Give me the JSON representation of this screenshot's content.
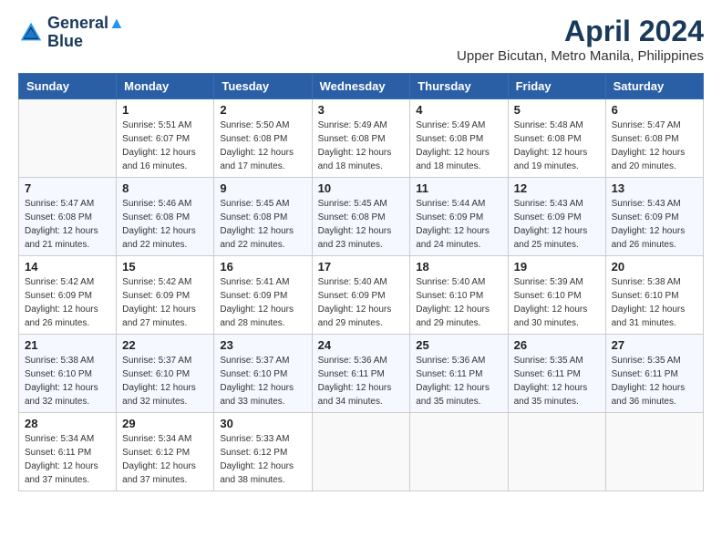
{
  "header": {
    "logo_line1": "General",
    "logo_line2": "Blue",
    "month": "April 2024",
    "location": "Upper Bicutan, Metro Manila, Philippines"
  },
  "columns": [
    "Sunday",
    "Monday",
    "Tuesday",
    "Wednesday",
    "Thursday",
    "Friday",
    "Saturday"
  ],
  "weeks": [
    [
      {
        "day": "",
        "info": ""
      },
      {
        "day": "1",
        "info": "Sunrise: 5:51 AM\nSunset: 6:07 PM\nDaylight: 12 hours\nand 16 minutes."
      },
      {
        "day": "2",
        "info": "Sunrise: 5:50 AM\nSunset: 6:08 PM\nDaylight: 12 hours\nand 17 minutes."
      },
      {
        "day": "3",
        "info": "Sunrise: 5:49 AM\nSunset: 6:08 PM\nDaylight: 12 hours\nand 18 minutes."
      },
      {
        "day": "4",
        "info": "Sunrise: 5:49 AM\nSunset: 6:08 PM\nDaylight: 12 hours\nand 18 minutes."
      },
      {
        "day": "5",
        "info": "Sunrise: 5:48 AM\nSunset: 6:08 PM\nDaylight: 12 hours\nand 19 minutes."
      },
      {
        "day": "6",
        "info": "Sunrise: 5:47 AM\nSunset: 6:08 PM\nDaylight: 12 hours\nand 20 minutes."
      }
    ],
    [
      {
        "day": "7",
        "info": "Sunrise: 5:47 AM\nSunset: 6:08 PM\nDaylight: 12 hours\nand 21 minutes."
      },
      {
        "day": "8",
        "info": "Sunrise: 5:46 AM\nSunset: 6:08 PM\nDaylight: 12 hours\nand 22 minutes."
      },
      {
        "day": "9",
        "info": "Sunrise: 5:45 AM\nSunset: 6:08 PM\nDaylight: 12 hours\nand 22 minutes."
      },
      {
        "day": "10",
        "info": "Sunrise: 5:45 AM\nSunset: 6:08 PM\nDaylight: 12 hours\nand 23 minutes."
      },
      {
        "day": "11",
        "info": "Sunrise: 5:44 AM\nSunset: 6:09 PM\nDaylight: 12 hours\nand 24 minutes."
      },
      {
        "day": "12",
        "info": "Sunrise: 5:43 AM\nSunset: 6:09 PM\nDaylight: 12 hours\nand 25 minutes."
      },
      {
        "day": "13",
        "info": "Sunrise: 5:43 AM\nSunset: 6:09 PM\nDaylight: 12 hours\nand 26 minutes."
      }
    ],
    [
      {
        "day": "14",
        "info": "Sunrise: 5:42 AM\nSunset: 6:09 PM\nDaylight: 12 hours\nand 26 minutes."
      },
      {
        "day": "15",
        "info": "Sunrise: 5:42 AM\nSunset: 6:09 PM\nDaylight: 12 hours\nand 27 minutes."
      },
      {
        "day": "16",
        "info": "Sunrise: 5:41 AM\nSunset: 6:09 PM\nDaylight: 12 hours\nand 28 minutes."
      },
      {
        "day": "17",
        "info": "Sunrise: 5:40 AM\nSunset: 6:09 PM\nDaylight: 12 hours\nand 29 minutes."
      },
      {
        "day": "18",
        "info": "Sunrise: 5:40 AM\nSunset: 6:10 PM\nDaylight: 12 hours\nand 29 minutes."
      },
      {
        "day": "19",
        "info": "Sunrise: 5:39 AM\nSunset: 6:10 PM\nDaylight: 12 hours\nand 30 minutes."
      },
      {
        "day": "20",
        "info": "Sunrise: 5:38 AM\nSunset: 6:10 PM\nDaylight: 12 hours\nand 31 minutes."
      }
    ],
    [
      {
        "day": "21",
        "info": "Sunrise: 5:38 AM\nSunset: 6:10 PM\nDaylight: 12 hours\nand 32 minutes."
      },
      {
        "day": "22",
        "info": "Sunrise: 5:37 AM\nSunset: 6:10 PM\nDaylight: 12 hours\nand 32 minutes."
      },
      {
        "day": "23",
        "info": "Sunrise: 5:37 AM\nSunset: 6:10 PM\nDaylight: 12 hours\nand 33 minutes."
      },
      {
        "day": "24",
        "info": "Sunrise: 5:36 AM\nSunset: 6:11 PM\nDaylight: 12 hours\nand 34 minutes."
      },
      {
        "day": "25",
        "info": "Sunrise: 5:36 AM\nSunset: 6:11 PM\nDaylight: 12 hours\nand 35 minutes."
      },
      {
        "day": "26",
        "info": "Sunrise: 5:35 AM\nSunset: 6:11 PM\nDaylight: 12 hours\nand 35 minutes."
      },
      {
        "day": "27",
        "info": "Sunrise: 5:35 AM\nSunset: 6:11 PM\nDaylight: 12 hours\nand 36 minutes."
      }
    ],
    [
      {
        "day": "28",
        "info": "Sunrise: 5:34 AM\nSunset: 6:11 PM\nDaylight: 12 hours\nand 37 minutes."
      },
      {
        "day": "29",
        "info": "Sunrise: 5:34 AM\nSunset: 6:12 PM\nDaylight: 12 hours\nand 37 minutes."
      },
      {
        "day": "30",
        "info": "Sunrise: 5:33 AM\nSunset: 6:12 PM\nDaylight: 12 hours\nand 38 minutes."
      },
      {
        "day": "",
        "info": ""
      },
      {
        "day": "",
        "info": ""
      },
      {
        "day": "",
        "info": ""
      },
      {
        "day": "",
        "info": ""
      }
    ]
  ]
}
